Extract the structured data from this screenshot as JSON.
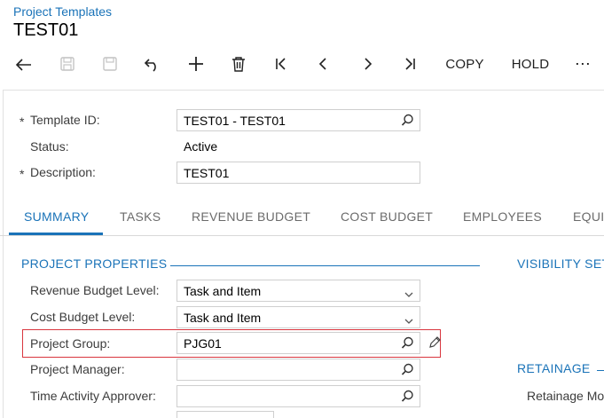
{
  "header": {
    "breadcrumb": "Project Templates",
    "title": "TEST01"
  },
  "toolbar": {
    "copy_label": "COPY",
    "hold_label": "HOLD",
    "more_label": "⋯"
  },
  "summary": {
    "template_id_label": "Template ID:",
    "template_id_value": "TEST01 - TEST01",
    "status_label": "Status:",
    "status_value": "Active",
    "description_label": "Description:",
    "description_value": "TEST01",
    "required_mark": "*"
  },
  "tabs": [
    {
      "label": "SUMMARY"
    },
    {
      "label": "TASKS"
    },
    {
      "label": "REVENUE BUDGET"
    },
    {
      "label": "COST BUDGET"
    },
    {
      "label": "EMPLOYEES"
    },
    {
      "label": "EQUI"
    }
  ],
  "project_properties": {
    "title": "PROJECT PROPERTIES",
    "revenue_budget_level_label": "Revenue Budget Level:",
    "revenue_budget_level_value": "Task and Item",
    "cost_budget_level_label": "Cost Budget Level:",
    "cost_budget_level_value": "Task and Item",
    "project_group_label": "Project Group:",
    "project_group_value": "PJG01",
    "project_manager_label": "Project Manager:",
    "project_manager_value": "",
    "time_activity_approver_label": "Time Activity Approver:",
    "time_activity_approver_value": ""
  },
  "visibility": {
    "title": "VISIBILITY SET"
  },
  "retainage": {
    "title": "RETAINAGE",
    "mode_label": "Retainage Mo"
  },
  "colors": {
    "accent": "#1a73b8",
    "highlight": "#d9363e"
  }
}
